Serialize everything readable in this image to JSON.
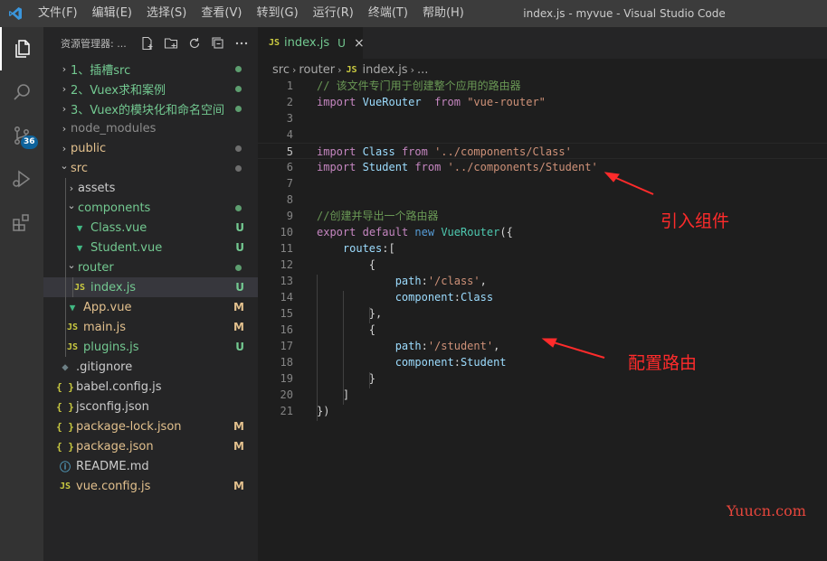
{
  "titlebar": {
    "menu": [
      "文件(F)",
      "编辑(E)",
      "选择(S)",
      "查看(V)",
      "转到(G)",
      "运行(R)",
      "终端(T)",
      "帮助(H)"
    ],
    "window_title": "index.js - myvue - Visual Studio Code"
  },
  "activity": {
    "icons": [
      "explorer-icon",
      "search-icon",
      "source-control-icon",
      "run-debug-icon",
      "extensions-icon"
    ],
    "scm_badge": "36"
  },
  "sidebar": {
    "title": "资源管理器: ...",
    "actions": [
      "new-file-icon",
      "new-folder-icon",
      "refresh-icon",
      "collapse-all-icon",
      "more-icon"
    ],
    "items": [
      {
        "label": "1、插槽src",
        "chevron": "›",
        "icon": "",
        "status": "",
        "dot": "green",
        "color": "green",
        "depth": 0
      },
      {
        "label": "2、Vuex求和案例",
        "chevron": "›",
        "icon": "",
        "status": "",
        "dot": "green",
        "color": "green",
        "depth": 0
      },
      {
        "label": "3、Vuex的模块化和命名空间",
        "chevron": "›",
        "icon": "",
        "status": "",
        "dot": "green",
        "color": "green",
        "depth": 0
      },
      {
        "label": "node_modules",
        "chevron": "›",
        "icon": "",
        "status": "",
        "dot": "",
        "color": "gray",
        "depth": 0
      },
      {
        "label": "public",
        "chevron": "›",
        "icon": "",
        "status": "",
        "dot": "gray",
        "color": "yellow",
        "depth": 0
      },
      {
        "label": "src",
        "chevron": "⌄",
        "icon": "",
        "status": "",
        "dot": "gray",
        "color": "yellow",
        "depth": 0
      },
      {
        "label": "assets",
        "chevron": "›",
        "icon": "",
        "status": "",
        "dot": "",
        "color": "default",
        "depth": 1
      },
      {
        "label": "components",
        "chevron": "⌄",
        "icon": "",
        "status": "",
        "dot": "green",
        "color": "green",
        "depth": 1
      },
      {
        "label": "Class.vue",
        "chevron": "",
        "icon": "vue",
        "status": "U",
        "dot": "",
        "color": "green",
        "depth": 2
      },
      {
        "label": "Student.vue",
        "chevron": "",
        "icon": "vue",
        "status": "U",
        "dot": "",
        "color": "green",
        "depth": 2
      },
      {
        "label": "router",
        "chevron": "⌄",
        "icon": "",
        "status": "",
        "dot": "green",
        "color": "green",
        "depth": 1
      },
      {
        "label": "index.js",
        "chevron": "",
        "icon": "js",
        "status": "U",
        "dot": "",
        "color": "green",
        "depth": 2,
        "selected": true
      },
      {
        "label": "App.vue",
        "chevron": "",
        "icon": "vue",
        "status": "M",
        "dot": "",
        "color": "yellow",
        "depth": 1
      },
      {
        "label": "main.js",
        "chevron": "",
        "icon": "js",
        "status": "M",
        "dot": "",
        "color": "yellow",
        "depth": 1
      },
      {
        "label": "plugins.js",
        "chevron": "",
        "icon": "js",
        "status": "U",
        "dot": "",
        "color": "green",
        "depth": 1
      },
      {
        "label": ".gitignore",
        "chevron": "",
        "icon": "git",
        "status": "",
        "dot": "",
        "color": "default",
        "depth": 0
      },
      {
        "label": "babel.config.js",
        "chevron": "",
        "icon": "json",
        "status": "",
        "dot": "",
        "color": "default",
        "depth": 0
      },
      {
        "label": "jsconfig.json",
        "chevron": "",
        "icon": "json",
        "status": "",
        "dot": "",
        "color": "default",
        "depth": 0
      },
      {
        "label": "package-lock.json",
        "chevron": "",
        "icon": "json",
        "status": "M",
        "dot": "",
        "color": "yellow",
        "depth": 0
      },
      {
        "label": "package.json",
        "chevron": "",
        "icon": "json",
        "status": "M",
        "dot": "",
        "color": "yellow",
        "depth": 0
      },
      {
        "label": "README.md",
        "chevron": "",
        "icon": "info",
        "status": "",
        "dot": "",
        "color": "default",
        "depth": 0
      },
      {
        "label": "vue.config.js",
        "chevron": "",
        "icon": "js",
        "status": "M",
        "dot": "",
        "color": "yellow",
        "depth": 0
      }
    ]
  },
  "editor": {
    "tab": {
      "icon": "JS",
      "name": "index.js",
      "status": "U",
      "close": "×"
    },
    "breadcrumb": [
      "src",
      "router",
      "index.js",
      "..."
    ],
    "current_line": 5,
    "lines": [
      [
        {
          "t": "// 该文件专门用于创建整个应用的路由器",
          "c": "cm"
        }
      ],
      [
        {
          "t": "import",
          "c": "kw2"
        },
        {
          "t": " VueRouter  ",
          "c": "id"
        },
        {
          "t": "from",
          "c": "kw2"
        },
        {
          "t": " ",
          "c": "punc"
        },
        {
          "t": "\"vue-router\"",
          "c": "str"
        }
      ],
      [],
      [],
      [
        {
          "t": "import",
          "c": "kw2"
        },
        {
          "t": " Class ",
          "c": "id"
        },
        {
          "t": "from",
          "c": "kw2"
        },
        {
          "t": " ",
          "c": "punc"
        },
        {
          "t": "'../components/Class'",
          "c": "str"
        }
      ],
      [
        {
          "t": "import",
          "c": "kw2"
        },
        {
          "t": " Student ",
          "c": "id"
        },
        {
          "t": "from",
          "c": "kw2"
        },
        {
          "t": " ",
          "c": "punc"
        },
        {
          "t": "'../components/Student'",
          "c": "str"
        }
      ],
      [],
      [],
      [
        {
          "t": "//创建并导出一个路由器",
          "c": "cm"
        }
      ],
      [
        {
          "t": "export",
          "c": "kw2"
        },
        {
          "t": " ",
          "c": "punc"
        },
        {
          "t": "default",
          "c": "kw2"
        },
        {
          "t": " ",
          "c": "punc"
        },
        {
          "t": "new",
          "c": "kw"
        },
        {
          "t": " ",
          "c": "punc"
        },
        {
          "t": "VueRouter",
          "c": "cls"
        },
        {
          "t": "({",
          "c": "punc"
        }
      ],
      [
        {
          "t": "    routes",
          "c": "id"
        },
        {
          "t": ":[",
          "c": "punc"
        }
      ],
      [
        {
          "t": "        {",
          "c": "punc"
        }
      ],
      [
        {
          "t": "            path",
          "c": "id"
        },
        {
          "t": ":",
          "c": "punc"
        },
        {
          "t": "'/class'",
          "c": "str"
        },
        {
          "t": ",",
          "c": "punc"
        }
      ],
      [
        {
          "t": "            component",
          "c": "id"
        },
        {
          "t": ":",
          "c": "punc"
        },
        {
          "t": "Class",
          "c": "id"
        }
      ],
      [
        {
          "t": "        },",
          "c": "punc"
        }
      ],
      [
        {
          "t": "        {",
          "c": "punc"
        }
      ],
      [
        {
          "t": "            path",
          "c": "id"
        },
        {
          "t": ":",
          "c": "punc"
        },
        {
          "t": "'/student'",
          "c": "str"
        },
        {
          "t": ",",
          "c": "punc"
        }
      ],
      [
        {
          "t": "            component",
          "c": "id"
        },
        {
          "t": ":",
          "c": "punc"
        },
        {
          "t": "Student",
          "c": "id"
        }
      ],
      [
        {
          "t": "        }",
          "c": "punc"
        }
      ],
      [
        {
          "t": "    ]",
          "c": "punc"
        }
      ],
      [
        {
          "t": "})",
          "c": "punc"
        }
      ]
    ]
  },
  "annotations": {
    "import_components": "引入组件",
    "configure_routes": "配置路由",
    "color": "#ff2b2b"
  },
  "watermark": "Yuucn.com"
}
